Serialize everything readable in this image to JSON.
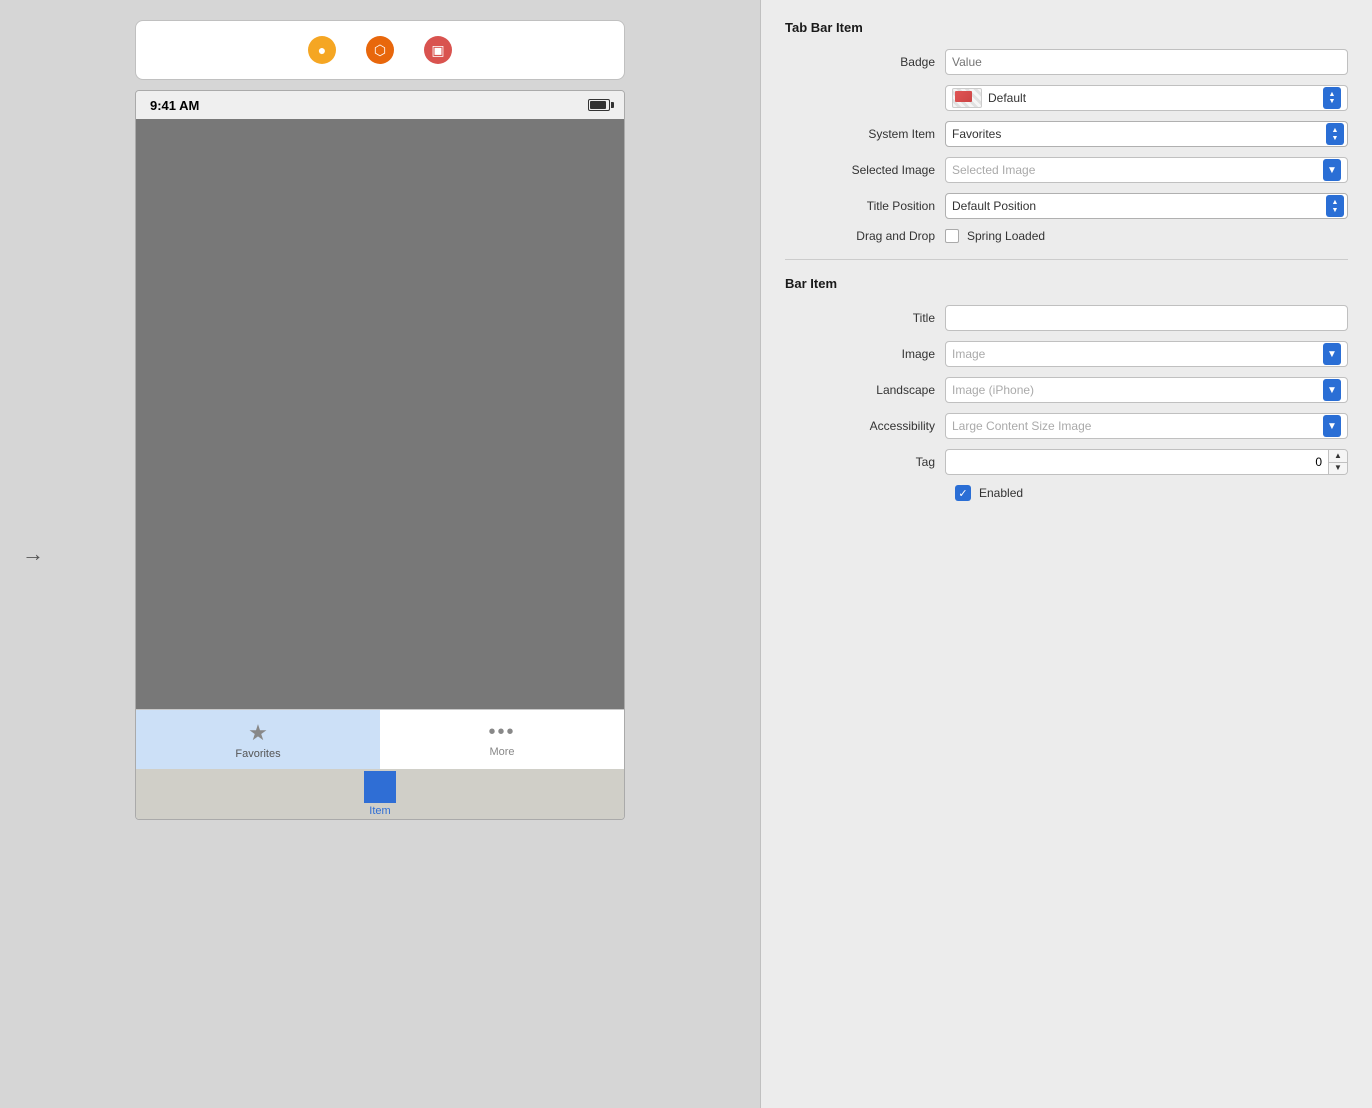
{
  "left": {
    "toolbar": {
      "icons": [
        "⬤",
        "⬡",
        "⬛"
      ]
    },
    "statusBar": {
      "time": "9:41 AM"
    },
    "tabs": [
      {
        "label": "Favorites",
        "icon": "★",
        "active": true
      },
      {
        "label": "More",
        "icon": "···",
        "active": false
      }
    ],
    "bottomBar": {
      "label": "Item"
    }
  },
  "right": {
    "tabBarItemSection": "Tab Bar Item",
    "barItemSection": "Bar Item",
    "fields": {
      "badge": {
        "label": "Badge",
        "placeholder": "Value"
      },
      "colorDefault": {
        "label": "",
        "value": "Default"
      },
      "systemItem": {
        "label": "System Item",
        "value": "Favorites"
      },
      "selectedImage": {
        "label": "Selected Image",
        "placeholder": "Selected Image"
      },
      "titlePosition": {
        "label": "Title Position",
        "value": "Default Position"
      },
      "dragAndDrop": {
        "label": "Drag and Drop",
        "checkboxLabel": "Spring Loaded"
      },
      "title": {
        "label": "Title",
        "value": ""
      },
      "image": {
        "label": "Image",
        "placeholder": "Image"
      },
      "landscape": {
        "label": "Landscape",
        "placeholder": "Image (iPhone)"
      },
      "accessibility": {
        "label": "Accessibility",
        "placeholder": "Large Content Size Image"
      },
      "tag": {
        "label": "Tag",
        "value": "0"
      },
      "enabled": {
        "label": "Enabled",
        "checked": true
      }
    }
  }
}
